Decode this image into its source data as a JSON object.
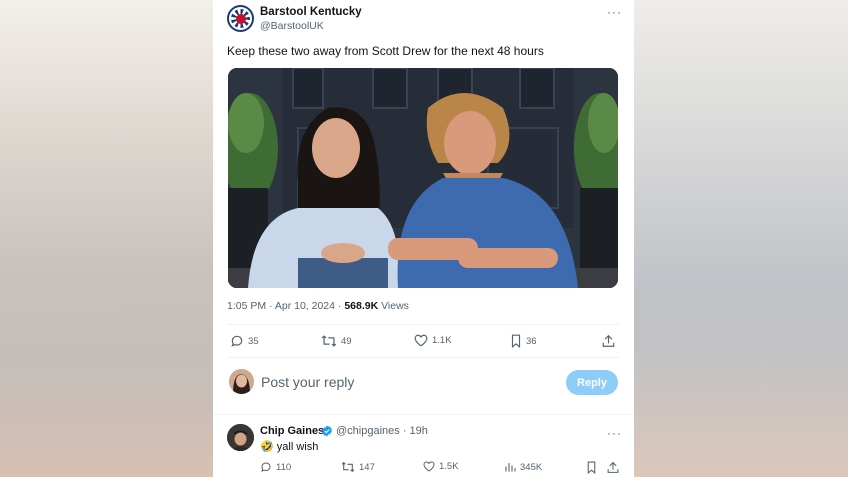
{
  "tweet": {
    "author_name": "Barstool Kentucky",
    "author_handle": "@BarstoolUK",
    "more_label": "···",
    "text": "Keep these two away from Scott Drew for the next 48 hours",
    "timestamp": "1:05 PM · Apr 10, 2024 · ",
    "views_count": "568.9K",
    "views_label": " Views",
    "actions": {
      "replies": "35",
      "retweets": "49",
      "likes": "1.1K",
      "bookmarks": "36"
    }
  },
  "composer": {
    "placeholder": "Post your reply",
    "button_label": "Reply"
  },
  "reply": {
    "author_name": "Chip Gaines",
    "author_meta": "@chipgaines · 19h",
    "emoji": "🤣",
    "text": " yall wish",
    "more_label": "···",
    "actions": {
      "replies": "110",
      "retweets": "147",
      "likes": "1.5K",
      "views": "345K"
    }
  },
  "colors": {
    "accent_disabled": "#8ecdf8",
    "verified": "#1d9bf0",
    "secondary_text": "#536471"
  }
}
